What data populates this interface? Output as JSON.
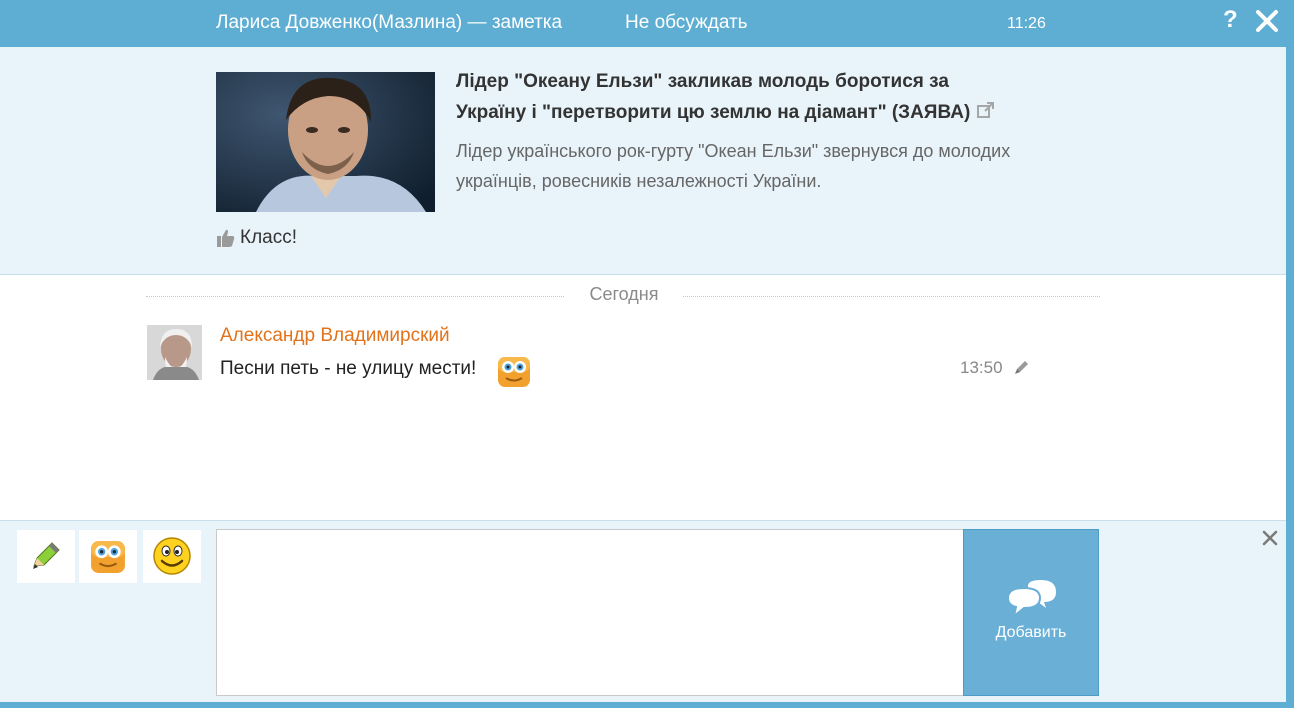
{
  "header": {
    "title": "Лариса Довженко(Мазлина) — заметка",
    "no_discuss": "Не обсуждать",
    "time": "11:26",
    "help": "?"
  },
  "note": {
    "headline_line1": "Лідер \"Океану Ельзи\" закликав молодь боротися за",
    "headline_line2": "Україну і \"перетворити цю землю на діамант\" (ЗАЯВА)",
    "desc_line1": "Лідер українського рок-гурту \"Океан Ельзи\" звернувся до молодих",
    "desc_line2": "українців, ровесників незалежності України.",
    "like_label": "Класс!"
  },
  "separator": {
    "label": "Сегодня"
  },
  "comment": {
    "author": "Александр Владимирский",
    "text": "Песни петь - не улицу мести!",
    "time": "13:50"
  },
  "composer": {
    "input_value": "",
    "add_label": "Добавить",
    "tools": [
      "pencil-icon",
      "sticker-icon",
      "smiley-icon"
    ]
  },
  "colors": {
    "header_bg": "#5eaed3",
    "note_bg": "#e9f4fa",
    "author": "#e2731a",
    "add_button": "#6ab0d6"
  }
}
